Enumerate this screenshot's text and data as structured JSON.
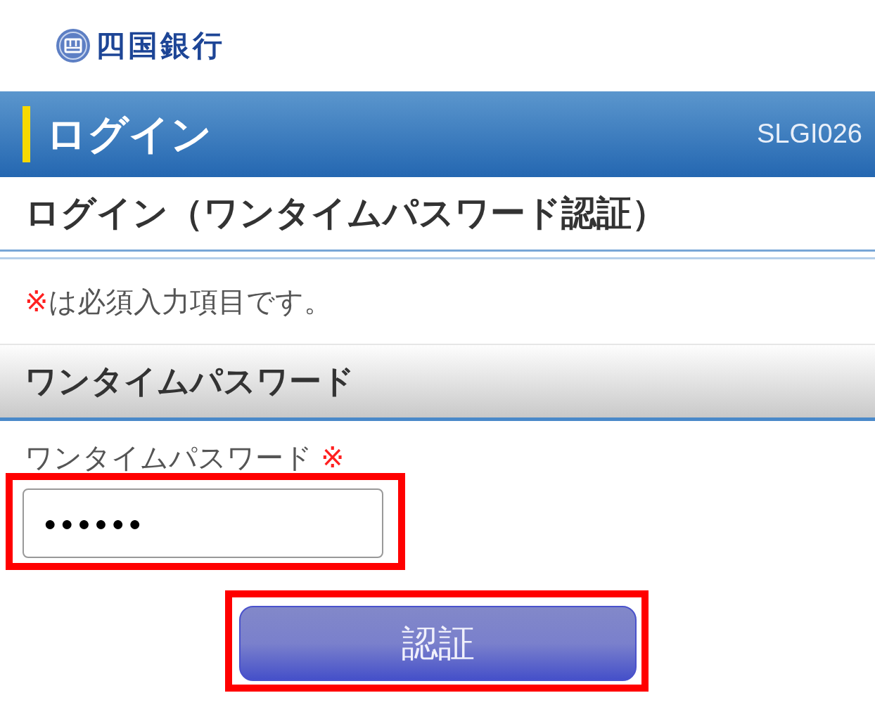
{
  "logo": {
    "text": "四国銀行"
  },
  "header": {
    "title": "ログイン",
    "screen_id": "SLGI026"
  },
  "page_title": "ログイン（ワンタイムパスワード認証）",
  "required_note": {
    "mark": "※",
    "text": "は必須入力項目です。"
  },
  "section": {
    "title": "ワンタイムパスワード"
  },
  "fields": [
    {
      "label": "ワンタイムパスワード",
      "required_mark": "※",
      "value": "●●●●●●",
      "highlighted": true
    }
  ],
  "buttons": [
    {
      "label": "認証",
      "highlighted": true
    }
  ]
}
